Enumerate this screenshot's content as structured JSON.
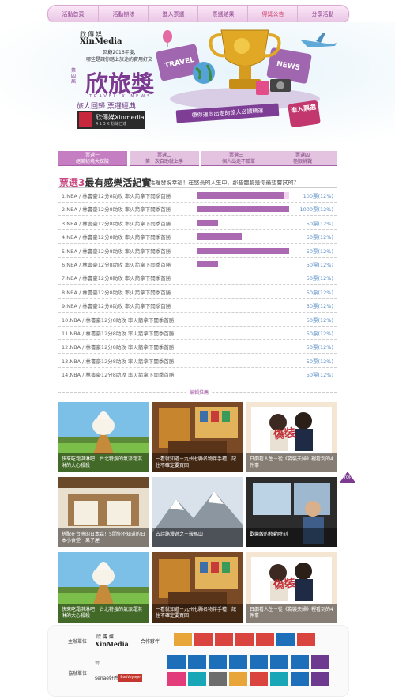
{
  "nav": {
    "items": [
      "活動首頁",
      "活動辦法",
      "進入票選",
      "票選結果",
      "得獎公告",
      "分享活動"
    ]
  },
  "banner": {
    "brand_cn": "欣傳媒",
    "brand_en": "XinMedia",
    "subtitle_1": "回顧2016年度,",
    "subtitle_2": "哪些是讓你踏上旅途的實用好文",
    "edition": "第四屆",
    "title": "欣旅獎",
    "title_en": "TRAVEL X NEWS",
    "tagline": "旅人回歸 票選經典",
    "logo_name": "欣傳媒Xinmedia",
    "logo_badge": "4 1 3 K 粉絲已達",
    "travel_label": "TRAVEL",
    "news_label": "NEWS",
    "ribbon": "帶你邁向出走的旅人必讀精選",
    "enter_label": "進入票選"
  },
  "tabs": [
    {
      "line1": "票選一",
      "line2": "絕美秘境大探險"
    },
    {
      "line1": "票選二",
      "line2": "第一次自助就上手"
    },
    {
      "line1": "票選三",
      "line2": "一個人出走不孤單"
    },
    {
      "line1": "票選四",
      "line2": "極限挑戰"
    }
  ],
  "vote": {
    "prefix": "票選3",
    "title": "最有感樂活紀實",
    "subtitle": ":生活裡發現幸福！在悠長的人生中，那些體驗是你最想嘗試的？",
    "rows": [
      {
        "label": "1.NBA / 林書豪12分8助攻 率火箭拿下開季首勝",
        "count": "100票(12%)",
        "fill": 0.95,
        "empty": false
      },
      {
        "label": "2.NBA / 林書豪12分8助攻 率火箭拿下開季首勝",
        "count": "1000票(12%)",
        "fill": 1.0,
        "empty": true
      },
      {
        "label": "3.NBA / 林書豪12分8助攻 率火箭拿下開季首勝",
        "count": "50票(12%)",
        "fill": 0.22,
        "empty": true
      },
      {
        "label": "4.NBA / 林書豪12分8助攻 率火箭拿下開季首勝",
        "count": "50票(12%)",
        "fill": 0.48,
        "empty": true
      },
      {
        "label": "5.NBA / 林書豪12分8助攻 率火箭拿下開季首勝",
        "count": "50票(12%)",
        "fill": 1.0,
        "empty": true
      },
      {
        "label": "6.NBA / 林書豪12分8助攻 率火箭拿下開季首勝",
        "count": "50票(12%)",
        "fill": 0.22,
        "empty": true
      },
      {
        "label": "7.NBA / 林書豪12分8助攻 率火箭拿下開季首勝",
        "count": "50票(12%)",
        "fill": 0,
        "empty": true
      },
      {
        "label": "8.NBA / 林書豪12分8助攻 率火箭拿下開季首勝",
        "count": "50票(12%)",
        "fill": 0,
        "empty": true
      },
      {
        "label": "9.NBA / 林書豪12分8助攻 率火箭拿下開季首勝",
        "count": "50票(12%)",
        "fill": 0,
        "empty": true
      },
      {
        "label": "10.NBA / 林書豪12分8助攻 率火箭拿下開季首勝",
        "count": "50票(12%)",
        "fill": 0,
        "empty": true
      },
      {
        "label": "11.NBA / 林書豪12分8助攻 率火箭拿下開季首勝",
        "count": "50票(12%)",
        "fill": 0,
        "empty": true
      },
      {
        "label": "12.NBA / 林書豪12分8助攻 率火箭拿下開季首勝",
        "count": "50票(12%)",
        "fill": 0,
        "empty": true
      },
      {
        "label": "13.NBA / 林書豪12分8助攻 率火箭拿下開季首勝",
        "count": "50票(12%)",
        "fill": 0,
        "empty": true
      },
      {
        "label": "14.NBA / 林書豪12分8助攻 率火箭拿下開季首勝",
        "count": "50票(12%)",
        "fill": 0,
        "empty": true
      }
    ]
  },
  "recommend": {
    "title": "編輯推薦",
    "cards": [
      {
        "caption": "快來吃霜淇淋吧！台北特搜的氣派霜淇淋的大心殺殺",
        "scene": "icecream"
      },
      {
        "caption": "一看就知道－九州七縣名物伴手禮，記住不確定要買回！",
        "scene": "shop"
      },
      {
        "caption": "日劇看人生－從《偽裝夫婦》裡看到的4件事",
        "scene": "drama"
      },
      {
        "caption": "搭配在台灣的日本森！5間你不知道的日本小食堂－果子屋",
        "scene": "store"
      },
      {
        "caption": "古詩路漫遊之－鞍馬山",
        "scene": "mountain"
      },
      {
        "caption": "歡樂飯的移動時刻",
        "scene": "train"
      },
      {
        "caption": "快來吃霜淇淋吧！台北特搜的氣派霜淇淋的大心殺殺",
        "scene": "icecream"
      },
      {
        "caption": "一看就知道－九州七縣名物伴手禮，記住不確定要買回！",
        "scene": "shop"
      },
      {
        "caption": "日劇看人生－從《偽裝夫婦》裡看到的4件事",
        "scene": "drama"
      }
    ],
    "drama_title": "偽裝",
    "top_label": "TOP"
  },
  "footer": {
    "host_label": "主辦單位",
    "host_brand_cn": "欣傳媒",
    "host_brand_en": "XinMedia",
    "partner_label": "合作夥伴",
    "co_label": "協辦單位",
    "co_brand_1": "senae好感",
    "co_brand_2": "BonVoyage",
    "sponsor_row1": [
      "#e8a53a",
      "#d9453e",
      "#d9453e",
      "#d9453e",
      "#d9453e",
      "#1c6fb8",
      "#d9453e"
    ],
    "sponsor_row2": [
      "#1c6fb8",
      "#1c6fb8",
      "#1c6fb8",
      "#1c6fb8",
      "#1c6fb8",
      "#1c6fb8",
      "#1c6fb8",
      "#6d3a8f"
    ],
    "sponsor_row3": [
      "#e23c7a",
      "#19a7b8",
      "#6d6d6d",
      "#e8a53a",
      "#d9453e",
      "#19a7b8",
      "#1c6fb8",
      "#6d3a8f"
    ]
  }
}
